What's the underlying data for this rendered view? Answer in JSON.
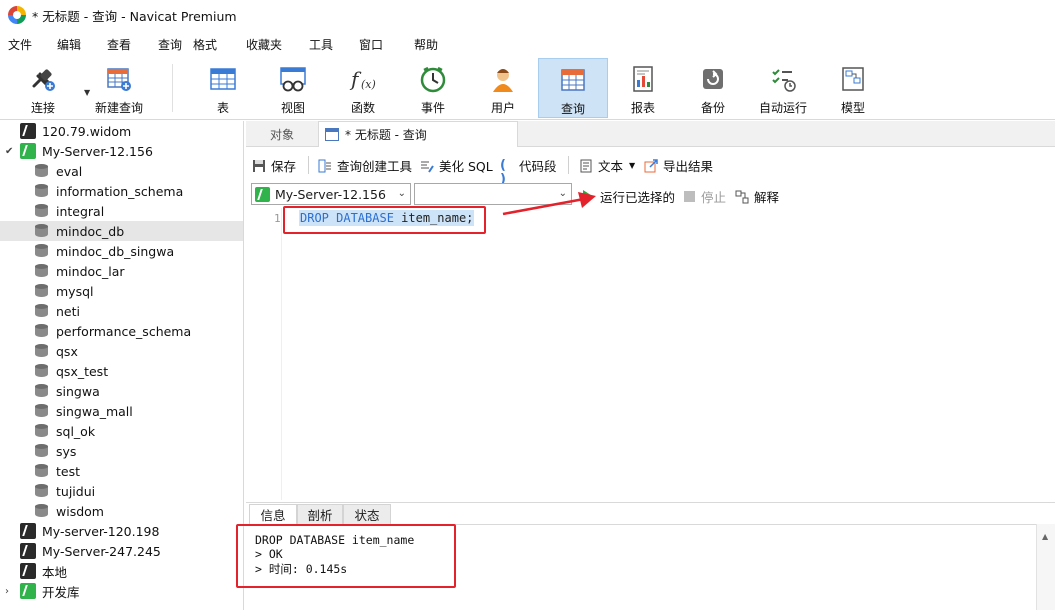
{
  "window": {
    "title": "* 无标题 - 查询 - Navicat Premium"
  },
  "menu": [
    "文件",
    "编辑",
    "查看",
    "查询",
    "格式",
    "收藏夹",
    "工具",
    "窗口",
    "帮助"
  ],
  "toolbar": {
    "connect": "连接",
    "new_query": "新建查询",
    "table": "表",
    "view": "视图",
    "function": "函数",
    "event": "事件",
    "user": "用户",
    "query": "查询",
    "report": "报表",
    "backup": "备份",
    "automation": "自动运行",
    "model": "模型"
  },
  "sidebar": {
    "connections": [
      {
        "name": "120.79.widom"
      },
      {
        "name": "My-Server-12.156",
        "expanded": true,
        "databases": [
          "eval",
          "information_schema",
          "integral",
          "mindoc_db",
          "mindoc_db_singwa",
          "mindoc_lar",
          "mysql",
          "neti",
          "performance_schema",
          "qsx",
          "qsx_test",
          "singwa",
          "singwa_mall",
          "sql_ok",
          "sys",
          "test",
          "tujidui",
          "wisdom"
        ],
        "selected": "mindoc_db"
      },
      {
        "name": "My-server-120.198"
      },
      {
        "name": "My-Server-247.245"
      },
      {
        "name": "本地"
      },
      {
        "name": "开发库"
      }
    ]
  },
  "tabs": {
    "objects": "对象",
    "query": "* 无标题 - 查询"
  },
  "query_toolbar": {
    "save": "保存",
    "query_builder": "查询创建工具",
    "beautify": "美化 SQL",
    "snippet": "代码段",
    "text": "文本",
    "export": "导出结果"
  },
  "selectors": {
    "connection": "My-Server-12.156",
    "database": ""
  },
  "run": {
    "run_selected": "运行已选择的",
    "stop": "停止",
    "explain": "解释"
  },
  "editor": {
    "line_number": "1",
    "keyword": "DROP DATABASE",
    "identifier": "item_name;"
  },
  "result_tabs": {
    "info": "信息",
    "profile": "剖析",
    "status": "状态"
  },
  "info_output": {
    "line1": "DROP DATABASE item_name",
    "line2": "> OK",
    "line3": "> 时间: 0.145s"
  },
  "colors": {
    "accent": "#cfe3f6",
    "highlight": "#e3222b",
    "keyword": "#2c6fd1",
    "run": "#2eaa3a"
  }
}
